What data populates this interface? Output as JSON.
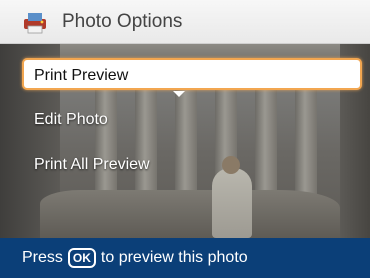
{
  "header": {
    "title": "Photo Options",
    "icon": "printer-photo-icon"
  },
  "menu": {
    "items": [
      {
        "label": "Print Preview",
        "selected": true
      },
      {
        "label": "Edit Photo",
        "selected": false
      },
      {
        "label": "Print All Preview",
        "selected": false
      }
    ]
  },
  "status": {
    "prefix": "Press",
    "key_label": "OK",
    "suffix": "to preview this photo"
  },
  "colors": {
    "accent": "#f2a650",
    "status_bar": "#0b3f78",
    "title_bar": "#f0f0f0"
  }
}
